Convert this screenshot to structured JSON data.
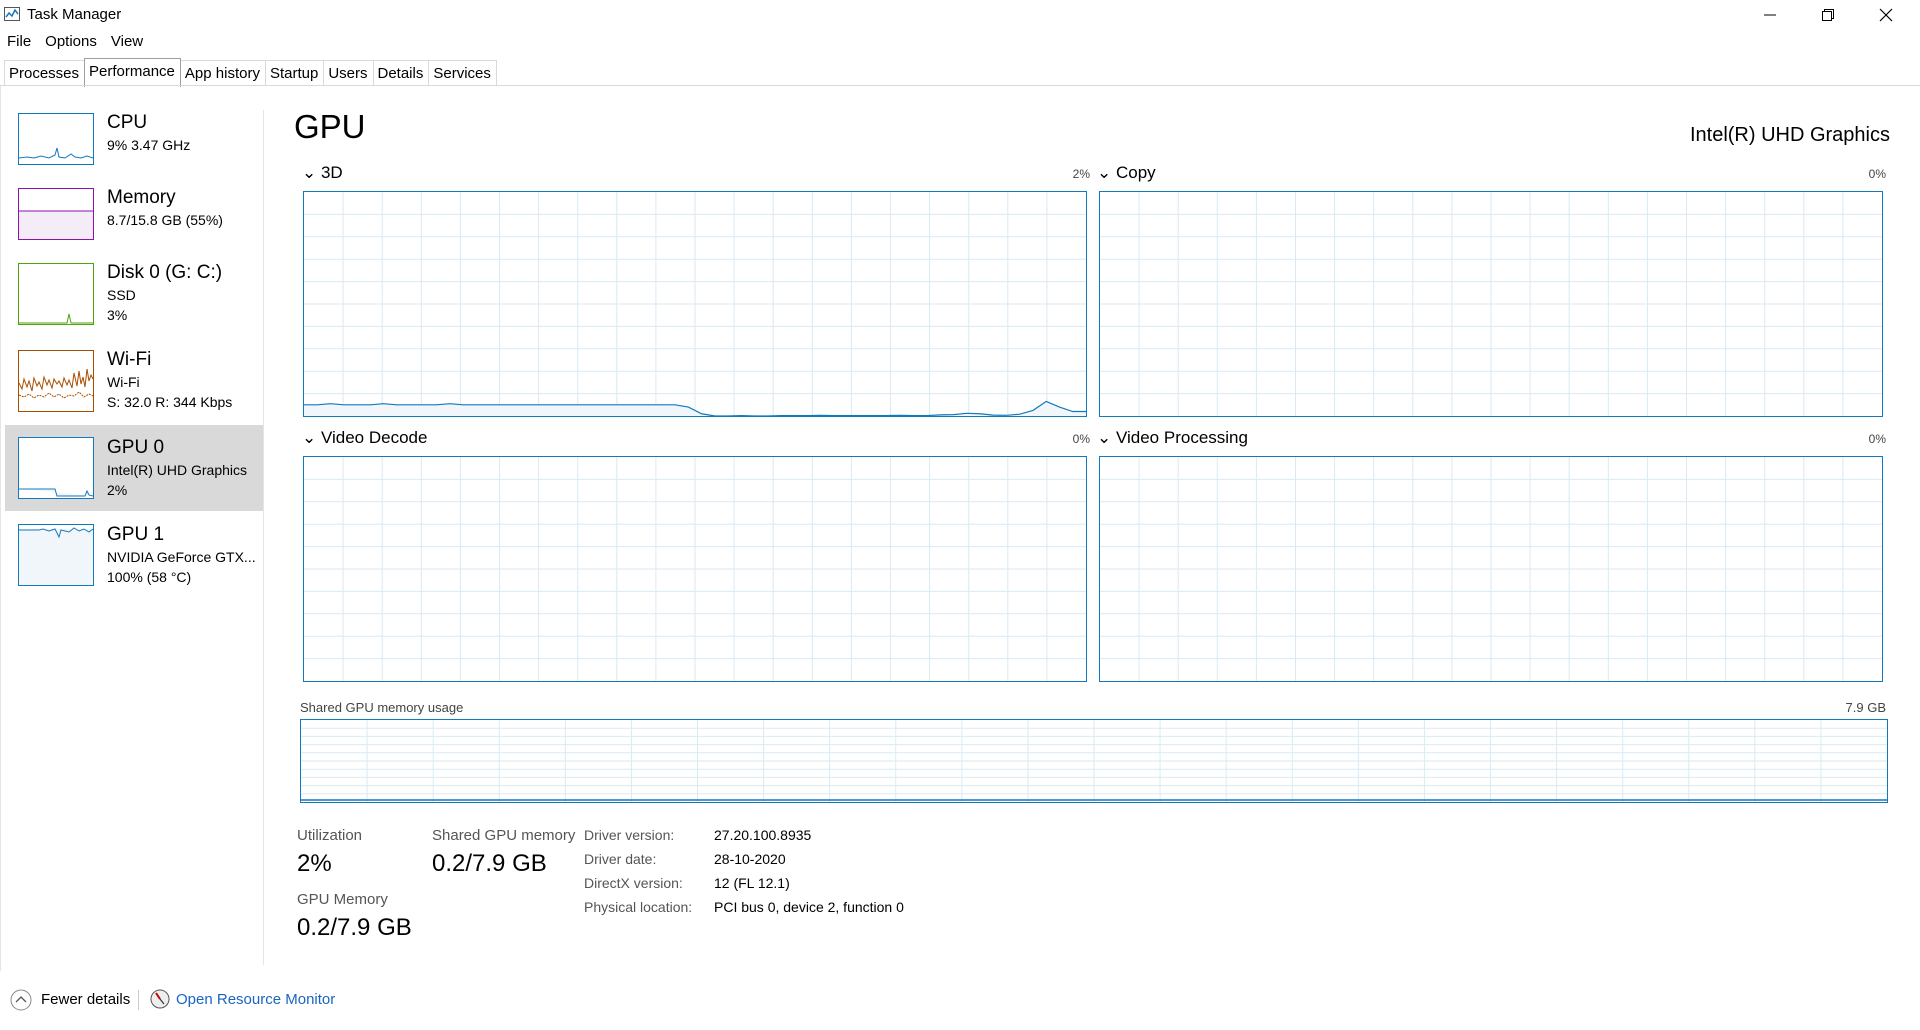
{
  "window": {
    "title": "Task Manager",
    "minimize_icon": "minimize-icon",
    "maximize_icon": "restore-icon",
    "close_icon": "close-icon"
  },
  "menu": [
    "File",
    "Options",
    "View"
  ],
  "tabs": [
    {
      "label": "Processes",
      "active": false
    },
    {
      "label": "Performance",
      "active": true
    },
    {
      "label": "App history",
      "active": false
    },
    {
      "label": "Startup",
      "active": false
    },
    {
      "label": "Users",
      "active": false
    },
    {
      "label": "Details",
      "active": false
    },
    {
      "label": "Services",
      "active": false
    }
  ],
  "sidebar": {
    "items": [
      {
        "title": "CPU",
        "lines": [
          "9%  3.47 GHz"
        ],
        "color": "#1379bd"
      },
      {
        "title": "Memory",
        "lines": [
          "8.7/15.8 GB (55%)"
        ],
        "color": "#8b12ae"
      },
      {
        "title": "Disk 0 (G: C:)",
        "lines": [
          "SSD",
          "3%"
        ],
        "color": "#4da60c"
      },
      {
        "title": "Wi-Fi",
        "lines": [
          "Wi-Fi",
          "S: 32.0  R: 344 Kbps"
        ],
        "color": "#a74f01"
      },
      {
        "title": "GPU 0",
        "lines": [
          "Intel(R) UHD Graphics",
          "2%"
        ],
        "color": "#1379bd",
        "selected": true
      },
      {
        "title": "GPU 1",
        "lines": [
          "NVIDIA GeForce GTX...",
          "100%  (58 °C)"
        ],
        "color": "#1379bd"
      }
    ]
  },
  "main": {
    "title": "GPU",
    "device_name": "Intel(R) UHD Graphics",
    "engines": [
      {
        "label": "3D",
        "percent": "2%"
      },
      {
        "label": "Copy",
        "percent": "0%"
      },
      {
        "label": "Video Decode",
        "percent": "0%"
      },
      {
        "label": "Video Processing",
        "percent": "0%"
      }
    ],
    "shared_memory_graph": {
      "label": "Shared GPU memory usage",
      "max": "7.9 GB"
    },
    "stats": {
      "utilization_label": "Utilization",
      "utilization_value": "2%",
      "shared_label": "Shared GPU memory",
      "shared_value": "0.2/7.9 GB",
      "gpu_memory_label": "GPU Memory",
      "gpu_memory_value": "0.2/7.9 GB"
    },
    "info": [
      {
        "label": "Driver version:",
        "value": "27.20.100.8935"
      },
      {
        "label": "Driver date:",
        "value": "28-10-2020"
      },
      {
        "label": "DirectX version:",
        "value": "12 (FL 12.1)"
      },
      {
        "label": "Physical location:",
        "value": "PCI bus 0, device 2, function 0"
      }
    ],
    "graph_color": "#1379bd",
    "graph_fill": "#f1f6fa",
    "grid_color": "#d9eaf4"
  },
  "footer": {
    "fewer_details": "Fewer details",
    "open_monitor": "Open Resource Monitor"
  },
  "chart_data": {
    "type": "line",
    "series": [
      {
        "name": "3D",
        "values": [
          5,
          5,
          5.5,
          5,
          5,
          5,
          5.5,
          5,
          5,
          5,
          5,
          5.5,
          5,
          5,
          5,
          5,
          5,
          5,
          5,
          5,
          5,
          5,
          5,
          5,
          5,
          5,
          5,
          5,
          5,
          4,
          1,
          0,
          0,
          0.2,
          0,
          0,
          0.2,
          0.2,
          0.2,
          0.3,
          0.2,
          0.2,
          0.2,
          0.2,
          0.2,
          0.3,
          0.2,
          0.2,
          0.5,
          0.6,
          1.2,
          1.0,
          0.4,
          0.3,
          0.8,
          2.5,
          6.5,
          4,
          2,
          2
        ]
      },
      {
        "name": "Copy",
        "values": []
      },
      {
        "name": "Video Decode",
        "values": []
      },
      {
        "name": "Video Processing",
        "values": []
      }
    ],
    "ylim": [
      0,
      100
    ]
  }
}
